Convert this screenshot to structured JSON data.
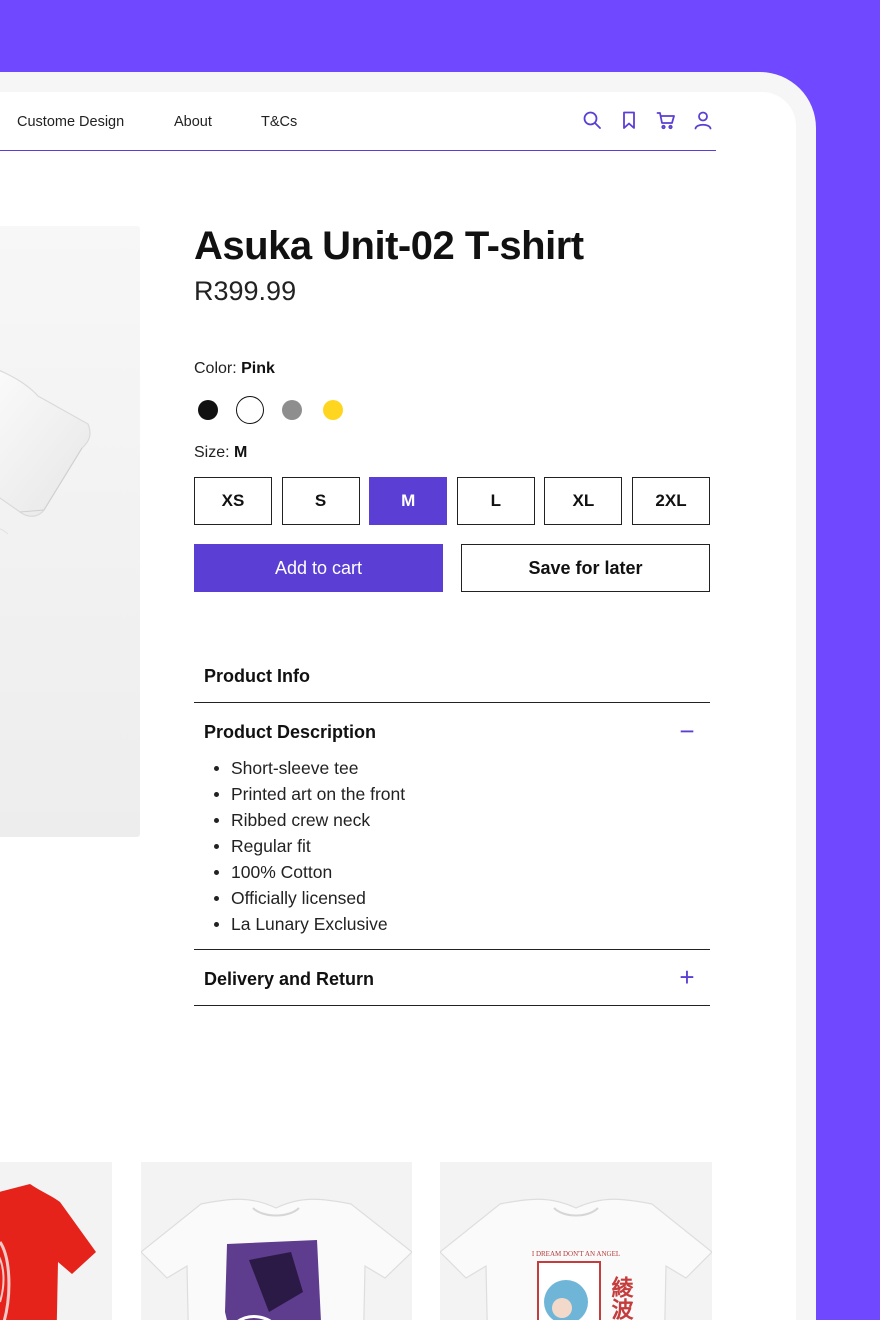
{
  "nav": {
    "links": [
      "Custome Design",
      "About",
      "T&Cs"
    ],
    "icons": [
      "search-icon",
      "bookmark-icon",
      "cart-icon",
      "user-icon"
    ],
    "accent_color": "#5B3FD4"
  },
  "product": {
    "title": "Asuka Unit-02 T-shirt",
    "price": "R399.99",
    "color_label": "Color: ",
    "selected_color": "Pink",
    "colors": [
      {
        "name": "black",
        "hex": "#111111"
      },
      {
        "name": "white",
        "hex": "#FFFFFF"
      },
      {
        "name": "grey",
        "hex": "#8E8E8E"
      },
      {
        "name": "yellow",
        "hex": "#FFD61F"
      }
    ],
    "size_label": "Size: ",
    "selected_size": "M",
    "sizes": [
      "XS",
      "S",
      "M",
      "L",
      "XL",
      "2XL"
    ],
    "add_to_cart_label": "Add to cart",
    "save_for_later_label": "Save for later"
  },
  "accordion": {
    "info_title": "Product Info",
    "description_title": "Product Description",
    "description_items": [
      "Short-sleeve tee",
      "Printed art on the front",
      "Ribbed crew neck",
      "Regular fit",
      "100% Cotton",
      "Officially licensed",
      "La Lunary Exclusive"
    ],
    "delivery_title": "Delivery and Return",
    "expanded_symbol": "−",
    "collapsed_symbol": "+"
  },
  "related": {
    "third_card_caption": "I DREAM DON'T AN ANGEL",
    "third_card_kanji": "綾波"
  },
  "colors": {
    "page_background": "#7048FF",
    "primary_button": "#5B3FD4"
  }
}
